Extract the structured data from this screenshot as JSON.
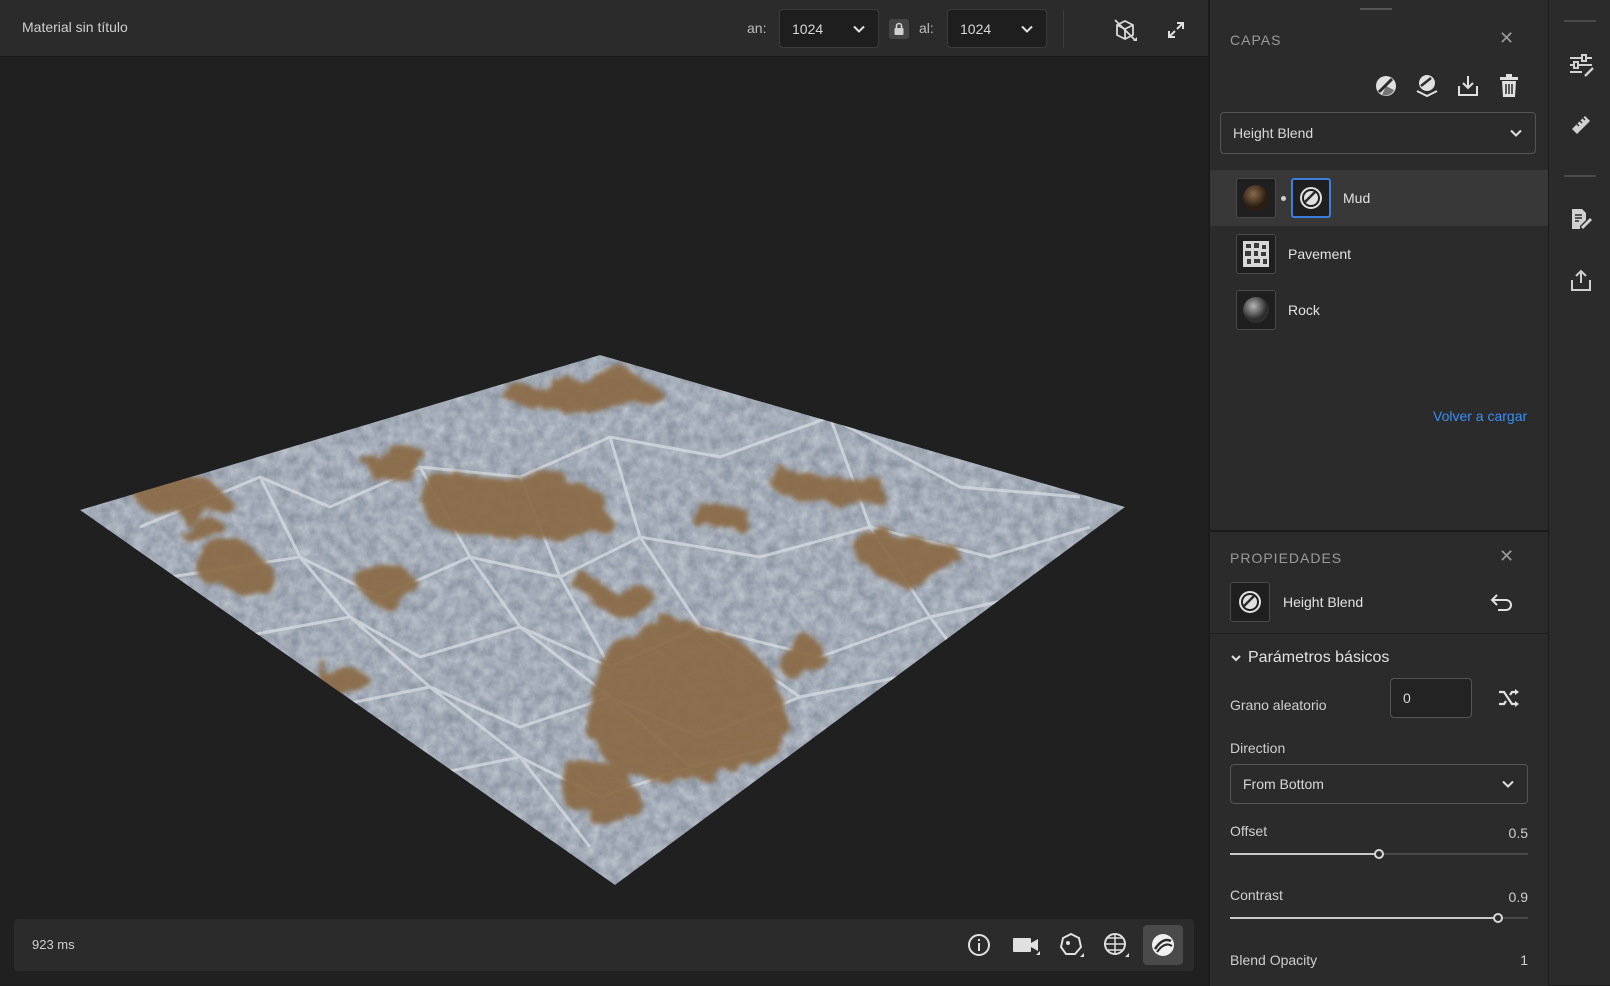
{
  "toolbar": {
    "material_title": "Material sin título",
    "width_label": "an:",
    "width_value": "1024",
    "height_label": "al:",
    "height_value": "1024"
  },
  "viewport": {
    "render_time": "923 ms"
  },
  "layers": {
    "title": "CAPAS",
    "blend_mode": "Height Blend",
    "items": [
      {
        "label": "Mud"
      },
      {
        "label": "Pavement"
      },
      {
        "label": "Rock"
      }
    ],
    "reload_label": "Volver a cargar"
  },
  "properties": {
    "title": "PROPIEDADES",
    "node_name": "Height Blend",
    "section_label": "Parámetros básicos",
    "seed_label": "Grano aleatorio",
    "seed_value": "0",
    "direction_label": "Direction",
    "direction_value": "From Bottom",
    "offset_label": "Offset",
    "offset_value": "0.5",
    "offset_level": 0.5,
    "contrast_label": "Contrast",
    "contrast_value": "0.9",
    "contrast_level": 0.9,
    "blend_opacity_label": "Blend Opacity",
    "blend_opacity_value": "1"
  },
  "colors": {
    "accent": "#3a7fe0",
    "link": "#3a8ef5",
    "panel": "#2b2b2b",
    "viewport": "#202020"
  },
  "icons": [
    "lock-icon",
    "chevron-down-icon",
    "view-mode-icon",
    "expand-icon",
    "info-icon",
    "camera-icon",
    "environment-icon",
    "uv-icon",
    "material-ball-icon",
    "add-fill-icon",
    "add-layer-icon",
    "import-icon",
    "trash-icon",
    "height-blend-icon",
    "reset-icon",
    "shuffle-icon",
    "adjustments-icon",
    "ruler-icon",
    "document-edit-icon",
    "export-icon",
    "close-icon"
  ]
}
